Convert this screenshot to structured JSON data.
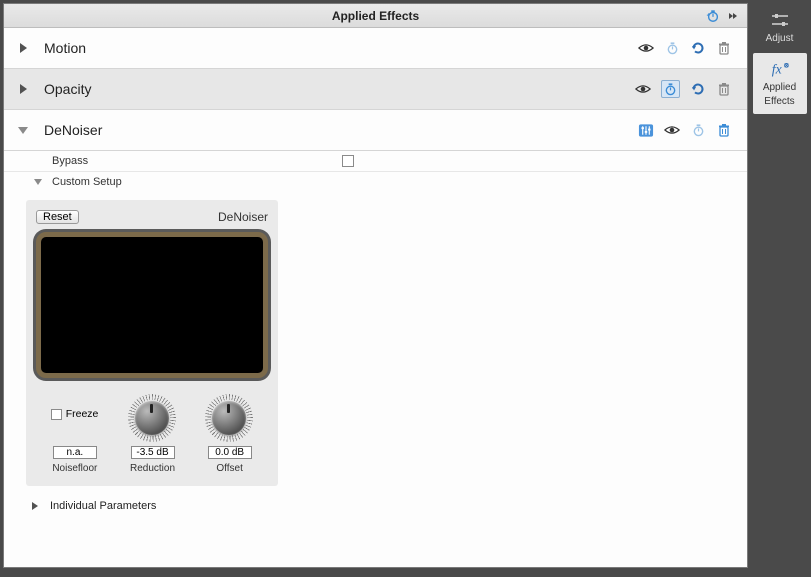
{
  "header": {
    "title": "Applied Effects"
  },
  "effects": [
    {
      "name": "Motion",
      "expanded": false
    },
    {
      "name": "Opacity",
      "expanded": false
    },
    {
      "name": "DeNoiser",
      "expanded": true
    }
  ],
  "denoiser": {
    "bypass_label": "Bypass",
    "custom_setup_label": "Custom Setup",
    "reset_label": "Reset",
    "plugin_name": "DeNoiser",
    "freeze_label": "Freeze",
    "noisefloor": {
      "value": "n.a.",
      "label": "Noisefloor"
    },
    "reduction": {
      "value": "-3.5 dB",
      "label": "Reduction"
    },
    "offset": {
      "value": "0.0 dB",
      "label": "Offset"
    },
    "individual_params_label": "Individual Parameters"
  },
  "rail": {
    "adjust": "Adjust",
    "applied_effects_line1": "Applied",
    "applied_effects_line2": "Effects"
  }
}
